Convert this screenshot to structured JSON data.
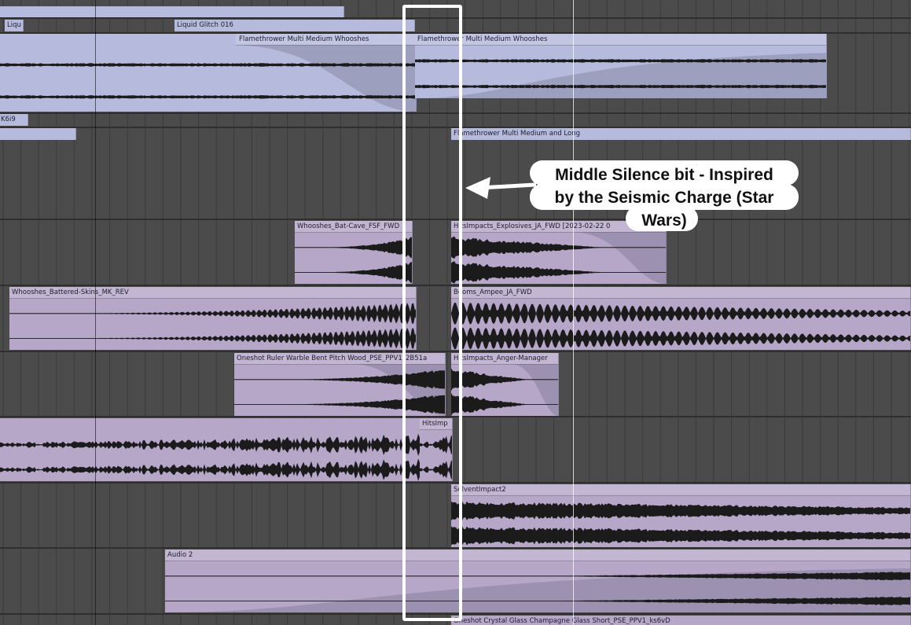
{
  "arrangement": {
    "clip_names": {
      "liqu": "Liqu",
      "liquid_glitch": "Liquid Glitch 016",
      "flamethrower_whooshes_a": "Flamethrower Multi Medium Whooshes",
      "flamethrower_whooshes_b": "Flamethrower Multi Medium Whooshes",
      "k6i9": "K6i9",
      "flamethrower_long": "Flamethrower Multi Medium and Long",
      "bat_cave": "Whooshes_Bat-Cave_FSF_FWD",
      "hits_explosives": "HitsImpacts_Explosives_JA_FWD [2023-02-22 0",
      "battered_skins": "Whooshes_Battered-Skins_MK_REV",
      "booms_ampee": "Booms_Ampee_JA_FWD",
      "ruler_warble": "Oneshot Ruler Warble Bent Pitch Wood_PSE_PPV1_2B51a",
      "anger_manager": "HitsImpacts_Anger-Manager",
      "hits_imp": "HitsImp",
      "solvent_impact": "SolventImpact2",
      "audio_2": "Audio 2",
      "crystal_glass": "Oneshot Crystal Glass Champagne Glass Short_PSE_PPV1_ks6vD"
    },
    "colors": {
      "background": "#4b4b4b",
      "blue_clip": "#b6badc",
      "purple_clip": "#b6a7c9",
      "waveform": "#1b1b1b",
      "highlight": "#ffffff"
    }
  },
  "annotation": {
    "callout_lines": [
      "Middle Silence bit - Inspired",
      "by the Seismic Charge (Star",
      "Wars)"
    ]
  }
}
